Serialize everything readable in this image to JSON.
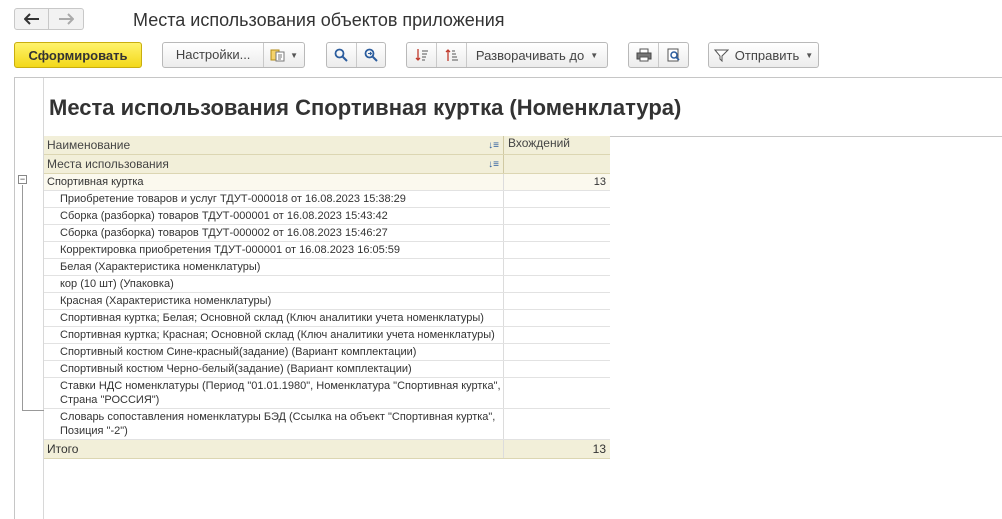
{
  "window": {
    "title": "Места использования объектов приложения"
  },
  "toolbar": {
    "generate_label": "Сформировать",
    "settings_label": "Настройки...",
    "expand_label": "Разворачивать до",
    "send_label": "Отправить"
  },
  "report": {
    "title": "Места использования Спортивная куртка (Номенклатура)",
    "columns": {
      "name": "Наименование",
      "usage": "Места использования",
      "count": "Вхождений"
    },
    "group": {
      "name": "Спортивная куртка",
      "count": "13"
    },
    "rows": [
      {
        "name": "Приобретение товаров и услуг ТДУТ-000018 от 16.08.2023 15:38:29"
      },
      {
        "name": "Сборка (разборка) товаров ТДУТ-000001 от 16.08.2023 15:43:42"
      },
      {
        "name": "Сборка (разборка) товаров ТДУТ-000002 от 16.08.2023 15:46:27"
      },
      {
        "name": "Корректировка приобретения ТДУТ-000001 от 16.08.2023 16:05:59"
      },
      {
        "name": "Белая (Характеристика номенклатуры)"
      },
      {
        "name": "кор (10 шт) (Упаковка)"
      },
      {
        "name": "Красная (Характеристика номенклатуры)"
      },
      {
        "name": "Спортивная куртка; Белая; Основной склад (Ключ аналитики учета номенклатуры)"
      },
      {
        "name": "Спортивная куртка; Красная; Основной склад (Ключ аналитики учета номенклатуры)"
      },
      {
        "name": "Спортивный костюм Сине-красный(задание) (Вариант комплектации)"
      },
      {
        "name": "Спортивный костюм Черно-белый(задание) (Вариант комплектации)"
      },
      {
        "name": "Ставки НДС номенклатуры (Период \"01.01.1980\", Номенклатура \"Спортивная куртка\", Страна \"РОССИЯ\")"
      },
      {
        "name": "Словарь сопоставления номенклатуры БЭД (Ссылка на объект \"Спортивная куртка\", Позиция \"-2\")"
      }
    ],
    "total": {
      "label": "Итого",
      "count": "13"
    }
  }
}
